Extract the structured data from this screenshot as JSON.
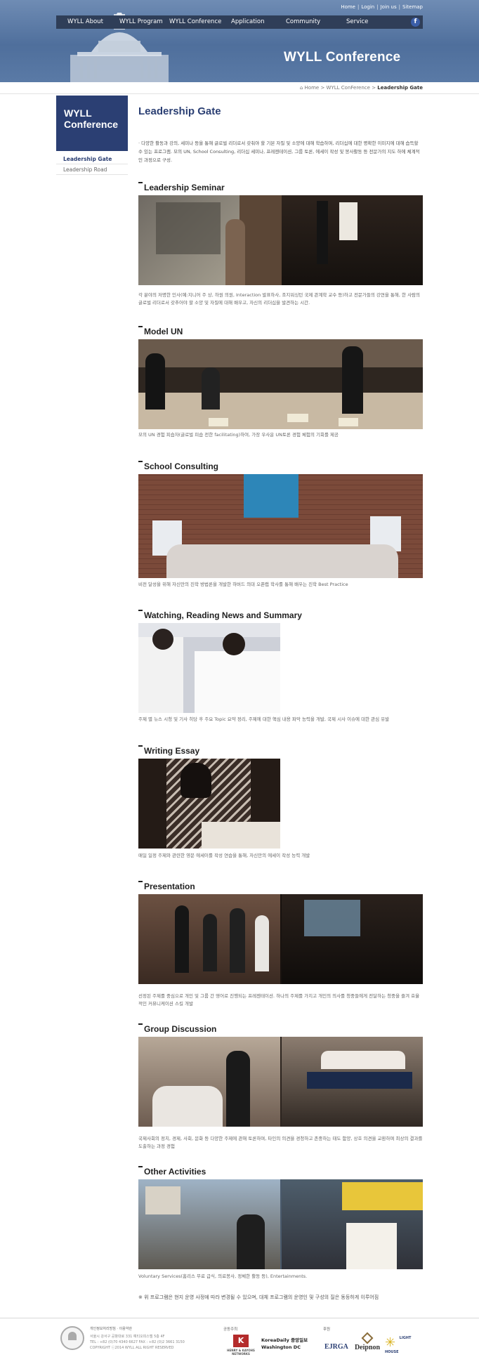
{
  "header": {
    "top_links": [
      "Home",
      "Login",
      "Join us",
      "Sitemap"
    ],
    "nav": [
      "WYLL About",
      "WYLL Program",
      "WYLL Conference",
      "Application",
      "Community",
      "Service"
    ],
    "facebook_icon": "facebook-icon",
    "hero_title": "WYLL Conference"
  },
  "breadcrumb": {
    "items": [
      "Home",
      "WYLL ConFerence",
      "Leadership Gate"
    ],
    "separator": ">"
  },
  "sidebar": {
    "title": "WYLL Conference",
    "items": [
      {
        "label": "Leadership Gate",
        "active": true
      },
      {
        "label": "Leadership Road",
        "active": false
      }
    ]
  },
  "main": {
    "page_title": "Leadership Gate",
    "intro": "· 다양한 활동과 강의, 세미나 등을 통해 글로벌 리더로서 갖춰야 할 기본 자질 및 소양에 대해 학습하며, 리더십에 대한 명확한 이미지에 대해 습득할 수 있는 프로그램. 모의 UN, School Consulting, 리더십 세미나, 프레젠테이션, 그룹 토론, 에세이 작성 및 봉사활동 등 전문가의 지도 하에 체계적인 과정으로 구성.",
    "sections": [
      {
        "title": "Leadership Seminar",
        "desc": "각 분야의 저명한 인사(예:지니어 주 상, 하원 의원, Interaction 발표하사, 조지워싱턴 국제 관계학 교수 등)하고 전문가들의 강연을 통해, 한 사람의 글로벌 리더로서 갖추어야 할 소양 및 자질에 대해 배우고, 자신의 리더십을 발견하는 시간."
      },
      {
        "title": "Model UN",
        "desc": "모의 UN 경험 피습자(글로벌 피습 전한 facilitating)하여, 가장 우사운 UN토론 경험 체험의 기회를 제공"
      },
      {
        "title": "School Consulting",
        "desc": "비전 달성을 위해 자신만의 진학 방법론을 개발한 하버드 의대 오픈랩 학사를 통해 배우는 진학 Best Practice"
      },
      {
        "title": "Watching, Reading News and Summary",
        "desc": "주제 별 뉴스 시청 및 기사 히당 후 주요 Topic 요약 정리, 주제에 대한 핵심 내용 파악 능력을 개발, 국제 시사 이슈에 대한 관심 유발"
      },
      {
        "title": "Writing Essay",
        "desc": "매일 일정 주제와 관련한 영문 에세이를 작성 연습을 통해, 자신만의 에세이 작성 능력 개발"
      },
      {
        "title": "Presentation",
        "desc": "선정된 주제를 중심으로 개인 및 그룹 간 영어로 진행되는 프레젠테이션. 하나의 주제를 가지고 개인의 의사를 청중들에게 전달하는 청중을 즐겨 효율적인 커뮤니케이션 스킬 개발"
      },
      {
        "title": "Group Discussion",
        "desc": "국제사회의 정치, 경제, 사회, 문화 등 다양한 주제에 관해 토론하며, 타인의 의견을 경청하고 존중하는 태도 함양, 상호 의견을 교환하며 최상의 결과를 도출하는 과정 경험"
      },
      {
        "title": "Other Activities",
        "desc": "Voluntary Services(홈리스 무료 급식, 의료봉사, 정체한 활동 등), Entertainments."
      }
    ],
    "notice": "※ 위 프로그램은 현지 운영 사정에 따라 변경될 수 있으며, 대체 프로그램의 운영인 및 구성의 질은 동등하게 이루어짐"
  },
  "footer": {
    "links": "개인정보처리방침 · 이용약관",
    "address": "서울시 강서구 공항대로 331 예티오피스텔 5층 4F",
    "tel": "TEL : +82 (0)70 4340 6627  FAX : +82 (0)2 3661 3150",
    "copyright": "COPYRIGHT ⓒ2014 WYLL ALL RIGHT RESERVED",
    "sponsor_label": "공동주최",
    "support_label": "후원",
    "sponsors": [
      "HENRY & KAYOHS NETWORKS",
      "KoreaDaily 중앙일보 Washington DC"
    ],
    "supporters": [
      "EJRGA",
      "Deipnon",
      "LIGHT HOUSE"
    ]
  }
}
